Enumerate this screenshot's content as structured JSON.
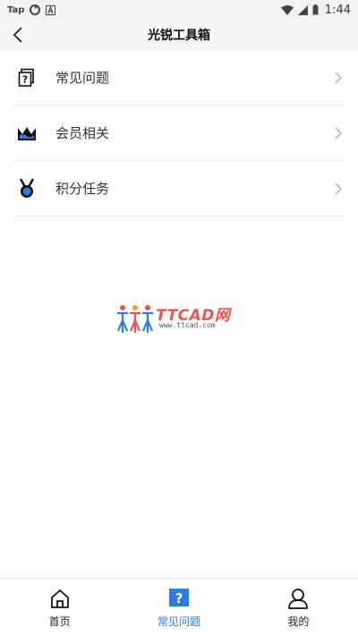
{
  "status_bar": {
    "carrier_label": "Tap",
    "time": "1:44"
  },
  "header": {
    "title": "光锐工具箱"
  },
  "menu": {
    "items": [
      {
        "label": "常见问题",
        "icon": "question-doc-icon"
      },
      {
        "label": "会员相关",
        "icon": "crown-icon"
      },
      {
        "label": "积分任务",
        "icon": "medal-icon"
      }
    ]
  },
  "watermark": {
    "brand": "TTCAD网",
    "url": "www.ttcad.com"
  },
  "tab_bar": {
    "tabs": [
      {
        "label": "首页",
        "icon": "home-icon",
        "active": false
      },
      {
        "label": "常见问题",
        "icon": "question-icon",
        "active": true
      },
      {
        "label": "我的",
        "icon": "user-icon",
        "active": false
      }
    ]
  },
  "colors": {
    "accent": "#2d7be5",
    "header_bg": "#f5f5f5",
    "divider": "#e6e6e6",
    "watermark_red": "#e8544e"
  }
}
